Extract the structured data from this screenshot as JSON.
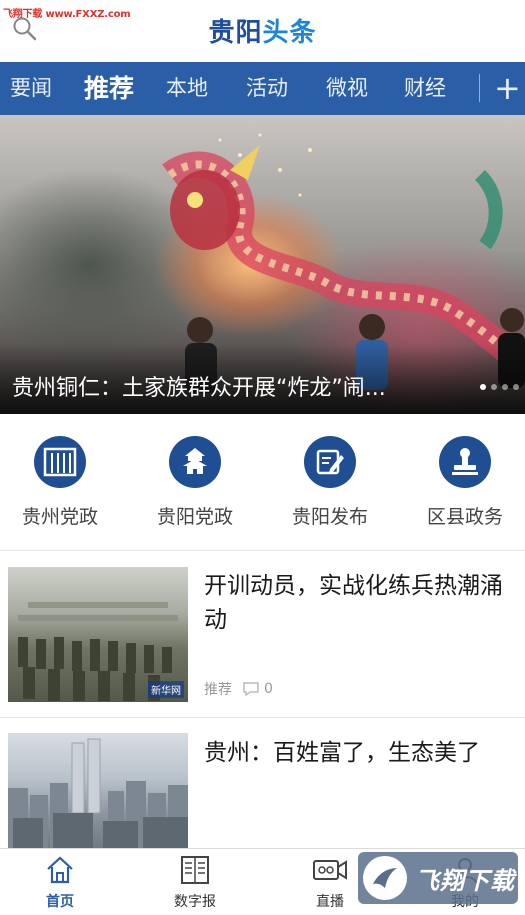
{
  "header": {
    "watermark": "飞翔下载 www.FXXZ.com",
    "brand_part1": "贵阳",
    "brand_part2": "头条"
  },
  "tabs": [
    {
      "label": "要闻"
    },
    {
      "label": "推荐",
      "active": true
    },
    {
      "label": "本地"
    },
    {
      "label": "活动"
    },
    {
      "label": "微视"
    },
    {
      "label": "财经"
    }
  ],
  "tab_add": "+",
  "banner": {
    "caption": "贵州铜仁：土家族群众开展“炸龙”闹...",
    "slides": 4,
    "current": 1
  },
  "quick_entries": [
    {
      "label": "贵州党政",
      "icon": "building-columns-icon"
    },
    {
      "label": "贵阳党政",
      "icon": "pagoda-icon"
    },
    {
      "label": "贵阳发布",
      "icon": "document-pen-icon"
    },
    {
      "label": "区县政务",
      "icon": "stamp-icon"
    }
  ],
  "news": [
    {
      "title": "开训动员，实战化练兵热潮涌动",
      "tag": "推荐",
      "comments": "0",
      "thumb_watermark": "新华网"
    },
    {
      "title": "贵州：百姓富了，生态美了"
    }
  ],
  "bottom_nav": [
    {
      "label": "首页",
      "icon": "home-icon",
      "active": true
    },
    {
      "label": "数字报",
      "icon": "newspaper-icon"
    },
    {
      "label": "直播",
      "icon": "video-camera-icon"
    },
    {
      "label": "我的",
      "icon": "user-icon"
    }
  ],
  "site_logo_text": "飞翔下载",
  "colors": {
    "brand_blue": "#2a5ea6",
    "icon_circle": "#1f4e93",
    "watermark_red": "#e0322b"
  }
}
